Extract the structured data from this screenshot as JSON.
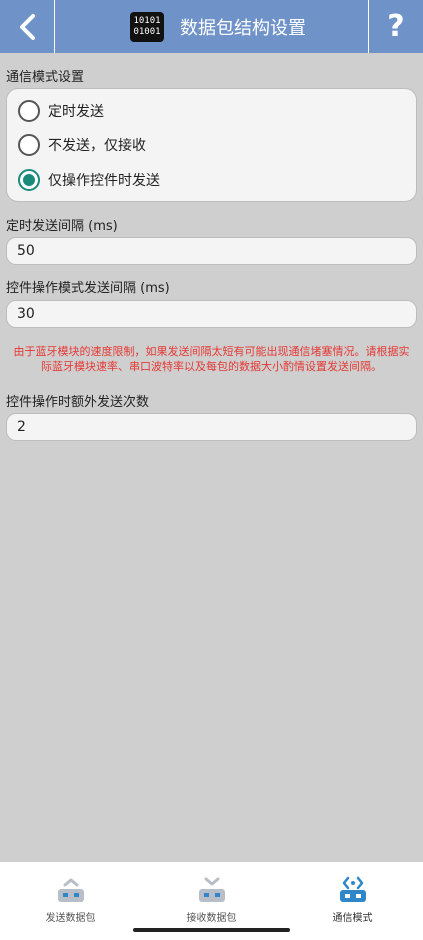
{
  "header": {
    "title": "数据包结构设置",
    "icon_lines": [
      "10101",
      "01001"
    ],
    "help_label": "?"
  },
  "comm_mode": {
    "label": "通信模式设置",
    "options": [
      {
        "label": "定时发送",
        "checked": false
      },
      {
        "label": "不发送，仅接收",
        "checked": false
      },
      {
        "label": "仅操作控件时发送",
        "checked": true
      }
    ]
  },
  "timer_interval": {
    "label": "定时发送间隔 (ms)",
    "value": "50"
  },
  "control_interval": {
    "label": "控件操作模式发送间隔 (ms)",
    "value": "30"
  },
  "warning": "由于蓝牙模块的速度限制，如果发送间隔太短有可能出现通信堵塞情况。请根据实际蓝牙模块速率、串口波特率以及每包的数据大小酌情设置发送间隔。",
  "extra_sends": {
    "label": "控件操作时额外发送次数",
    "value": "2"
  },
  "bottom_nav": [
    {
      "label": "发送数据包",
      "icon": "send-packet-icon",
      "active": false
    },
    {
      "label": "接收数据包",
      "icon": "receive-packet-icon",
      "active": false
    },
    {
      "label": "通信模式",
      "icon": "comm-mode-icon",
      "active": true
    }
  ],
  "colors": {
    "header": "#6f93c8",
    "accent": "#1a8a7a",
    "warning": "#e53935",
    "active_nav": "#2f86c9",
    "inactive_nav": "#b7bec8"
  }
}
